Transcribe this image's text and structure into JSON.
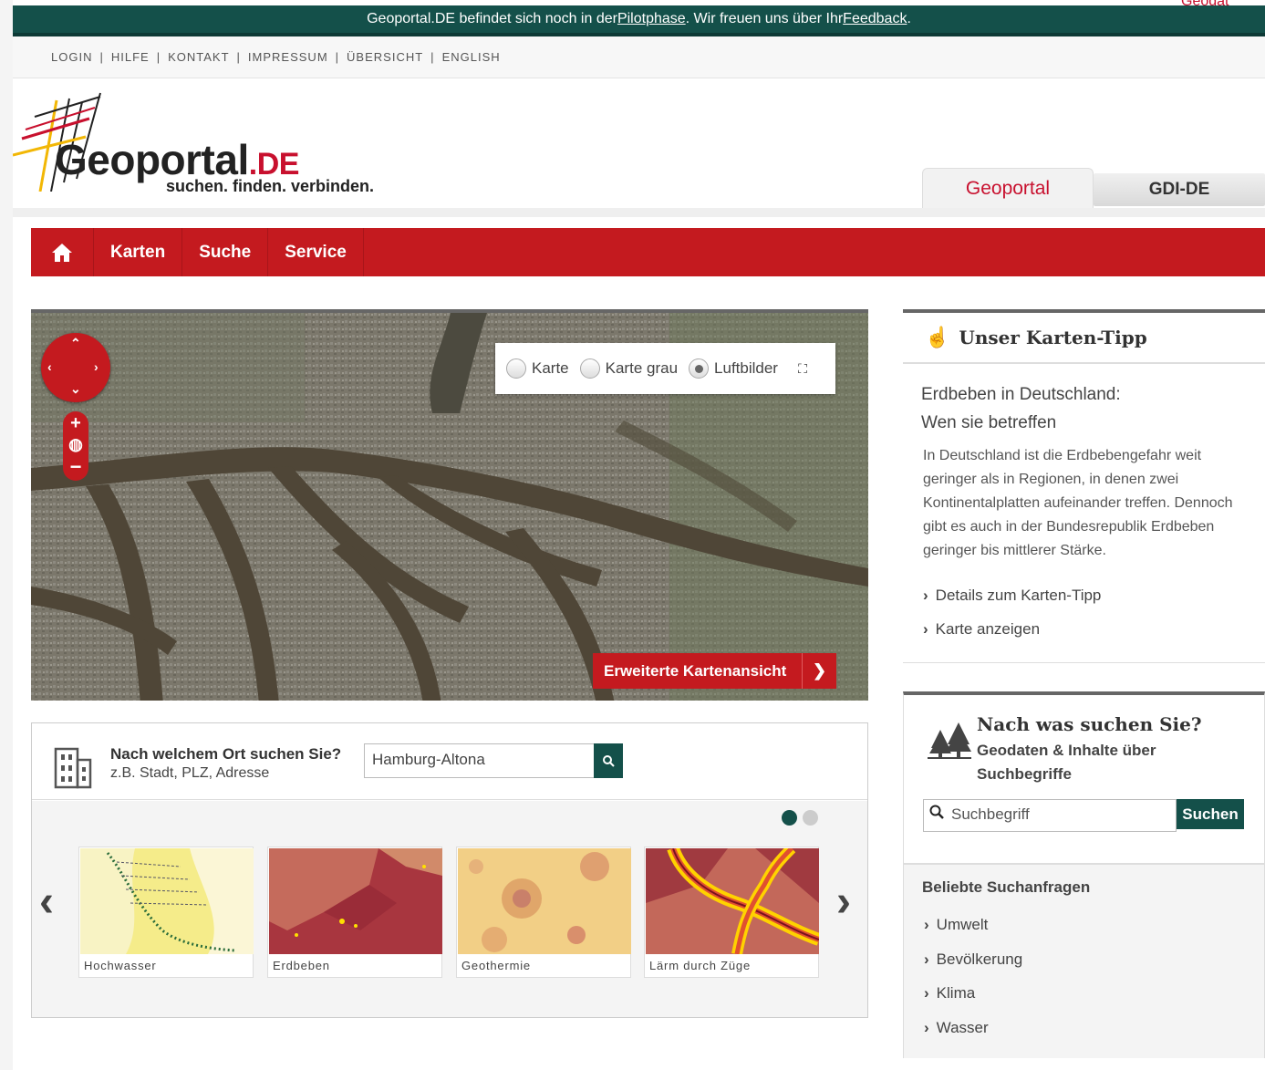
{
  "banner": {
    "text_before": "Geoportal.DE befindet sich noch in der ",
    "link_pilot": "Pilotphase",
    "text_mid": ". Wir freuen uns über Ihr ",
    "link_feedback": "Feedback",
    "text_after": ".",
    "corner_text": "Geodat"
  },
  "toplinks": [
    "LOGIN",
    "HILFE",
    "KONTAKT",
    "IMPRESSUM",
    "ÜBERSICHT",
    "ENGLISH"
  ],
  "logo": {
    "word": "Geoportal",
    "suffix": ".DE",
    "slogan": "suchen. finden. verbinden."
  },
  "tabs": [
    {
      "label": "Geoportal",
      "active": true
    },
    {
      "label": "GDI-DE",
      "active": false
    }
  ],
  "nav": {
    "home_icon": "home-icon",
    "items": [
      "Karten",
      "Suche",
      "Service"
    ]
  },
  "map": {
    "layer_options": [
      {
        "label": "Karte",
        "selected": false
      },
      {
        "label": "Karte grau",
        "selected": false
      },
      {
        "label": "Luftbilder",
        "selected": true
      }
    ],
    "extended_view_button": "Erweiterte Kartenansicht"
  },
  "location_search": {
    "question": "Nach welchem Ort suchen Sie?",
    "hint": "z.B. Stadt, PLZ, Adresse",
    "value": "Hamburg-Altona"
  },
  "carousel": {
    "items": [
      "Hochwasser",
      "Erdbeben",
      "Geothermie",
      "Lärm durch Züge"
    ],
    "page": 1,
    "pages": 2
  },
  "tip": {
    "heading": "Unser Karten-Tipp",
    "title_line1": "Erdbeben in Deutschland:",
    "title_line2": "Wen sie betreffen",
    "text": "In Deutschland ist die Erdbebengefahr weit geringer als in Regionen, in denen zwei Kontinentalplatten aufeinander treffen. Den­noch gibt es auch in der Bundesrepublik Erdbeben geringer bis mittlerer Stärke.",
    "links": [
      "Details zum Karten-Tipp",
      "Karte anzeigen"
    ]
  },
  "search": {
    "question": "Nach was suchen Sie?",
    "subtitle": "Geodaten & Inhalte über Suchbegriffe",
    "placeholder": "Suchbegriff",
    "button": "Suchen",
    "popular_heading": "Beliebte Suchanfragen",
    "popular": [
      "Umwelt",
      "Bevölkerung",
      "Klima",
      "Wasser"
    ]
  },
  "colors": {
    "brand_red": "#c41a1f",
    "brand_green": "#14504a"
  }
}
